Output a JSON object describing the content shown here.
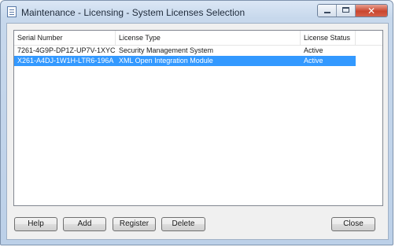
{
  "window": {
    "title": "Maintenance - Licensing - System Licenses Selection",
    "minimize_label": "",
    "maximize_label": "",
    "close_label": "✕"
  },
  "table": {
    "columns": [
      "Serial Number",
      "License Type",
      "License Status"
    ],
    "rows": [
      {
        "serial": "7261-4G9P-DP1Z-UP7V-1XYC",
        "type": "Security Management System",
        "status": "Active",
        "selected": false
      },
      {
        "serial": "X261-A4DJ-1W1H-LTR6-196A",
        "type": "XML Open Integration Module",
        "status": "Active",
        "selected": true
      }
    ]
  },
  "buttons": {
    "help": "Help",
    "add": "Add",
    "register": "Register",
    "delete": "Delete",
    "close": "Close"
  },
  "colors": {
    "selection": "#3399ff",
    "close_button": "#c9462f"
  },
  "icons": {
    "app": "document-icon",
    "minimize": "minimize-icon",
    "maximize": "maximize-icon",
    "close": "close-icon"
  }
}
